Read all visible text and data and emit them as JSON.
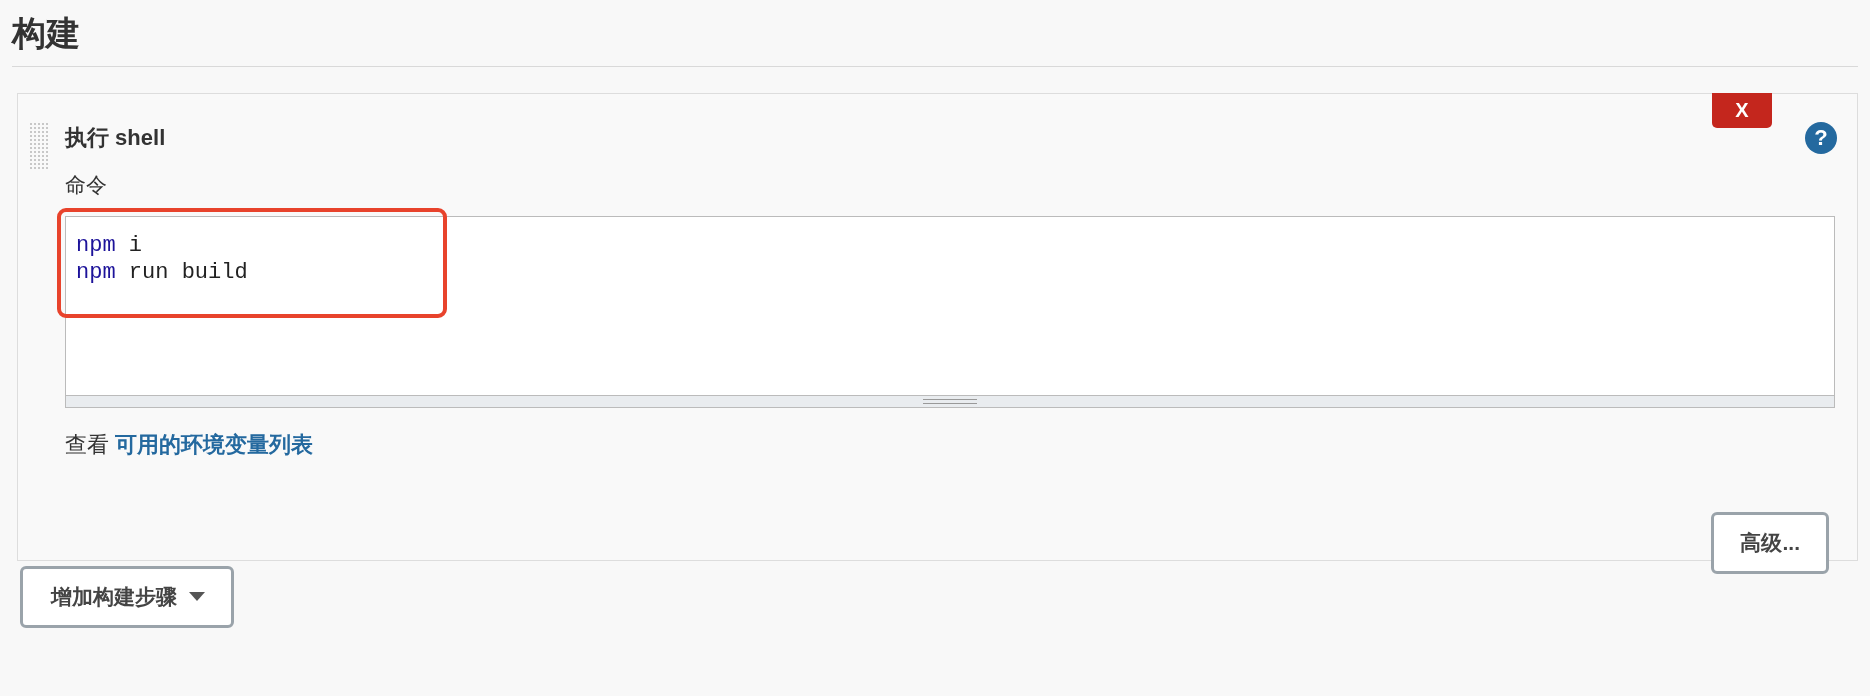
{
  "section": {
    "title": "构建"
  },
  "step": {
    "title": "执行 shell",
    "delete_label": "X",
    "help_label": "?",
    "field": {
      "label": "命令",
      "highlighted": true,
      "lines": [
        {
          "tokens": [
            {
              "text": "npm",
              "kind": "keyword"
            },
            {
              "text": "i",
              "kind": "plain"
            }
          ]
        },
        {
          "tokens": [
            {
              "text": "npm",
              "kind": "keyword"
            },
            {
              "text": "run",
              "kind": "plain"
            },
            {
              "text": "build",
              "kind": "plain"
            }
          ]
        }
      ]
    },
    "hint": {
      "text": "查看",
      "link": "可用的环境变量列表"
    },
    "advanced_button": "高级..."
  },
  "add_step_button": "增加构建步骤"
}
